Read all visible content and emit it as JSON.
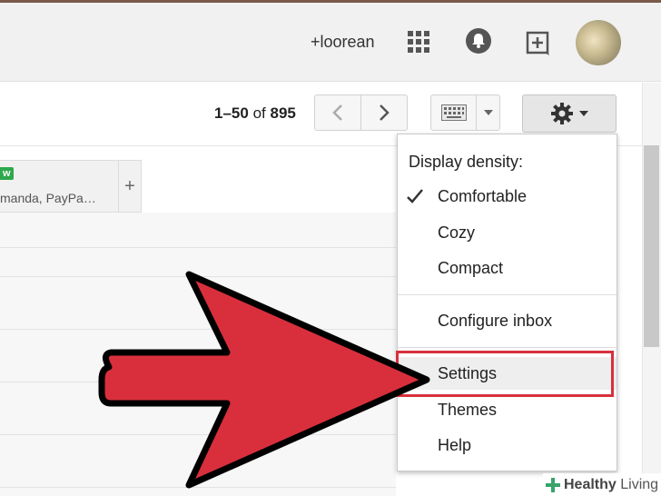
{
  "header": {
    "user_link": "+loorean",
    "icons": [
      "apps-grid-icon",
      "notifications-bell-icon",
      "share-plus-icon"
    ],
    "avatar": "account-avatar"
  },
  "toolbar": {
    "count_range": "1–50",
    "count_of": "of",
    "count_total": "895",
    "prev_icon": "chevron-left-icon",
    "next_icon": "chevron-right-icon",
    "keyboard_icon": "keyboard-icon",
    "settings_icon": "gear-icon"
  },
  "tabs": {
    "badge": "w",
    "senders": "manda, PayPa…",
    "add_label": "+"
  },
  "menu": {
    "heading": "Display density:",
    "items": [
      {
        "label": "Comfortable",
        "checked": true
      },
      {
        "label": "Cozy",
        "checked": false
      },
      {
        "label": "Compact",
        "checked": false
      },
      {
        "label": "Configure inbox",
        "checked": false
      },
      {
        "label": "Settings",
        "checked": false,
        "highlighted": true
      },
      {
        "label": "Themes",
        "checked": false
      },
      {
        "label": "Help",
        "checked": false
      }
    ]
  },
  "overlay": {
    "arrow_color": "#d92f3d",
    "highlight_box_color": "#d8303c"
  },
  "watermark": {
    "bold": "Healthy",
    "rest": " Living"
  },
  "colors": {
    "header_bg": "#f1f1f1",
    "badge_green": "#2da84a"
  }
}
